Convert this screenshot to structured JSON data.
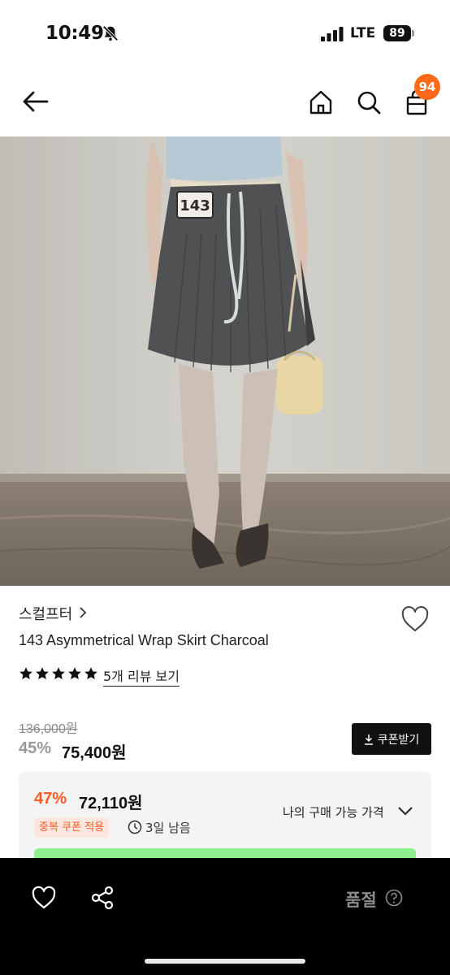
{
  "status_bar": {
    "time": "10:49",
    "network": "LTE",
    "battery": "89"
  },
  "nav": {
    "cart_count": "94"
  },
  "product": {
    "brand": "스컬프터",
    "title": "143 Asymmetrical Wrap Skirt Charcoal",
    "rating_stars": 5,
    "review_link": "5개 리뷰 보기",
    "original_price": "136,000원",
    "discount_rate": "45%",
    "sale_price": "75,400원",
    "coupon_button": "쿠폰받기"
  },
  "benefit": {
    "rate": "47%",
    "price": "72,110원",
    "coupon_tag": "중복 쿠폰 적용",
    "time_left": "3일 남음",
    "my_price_label": "나의 구매 가능 가격"
  },
  "bottom_bar": {
    "status_label": "품절"
  },
  "colors": {
    "accent": "#ff5a1f",
    "badge": "#ff6a1a",
    "bottom_bar": "#000000",
    "promo_strip": "#8ef08e"
  }
}
